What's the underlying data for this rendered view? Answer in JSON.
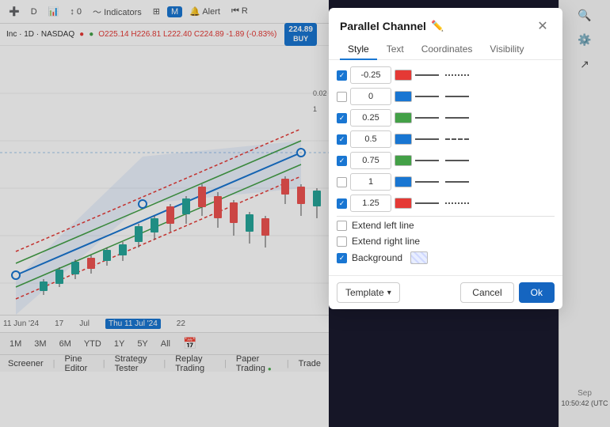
{
  "chart": {
    "stock": "Inc · 1D · NASDAQ",
    "ohlc": "O225.14 H226.81 L222.40 C224.89 -1.89 (-0.83%)",
    "price": "224.89",
    "price_action": "BUY",
    "time_axis": [
      "11 Jun '24",
      "17",
      "Jul",
      "22"
    ],
    "time_current": "Thu 11 Jul '24",
    "periods": [
      "1M",
      "3M",
      "6M",
      "YTD",
      "1Y",
      "5Y",
      "All"
    ],
    "footer_nav": [
      "Screener",
      "Pine Editor",
      "Strategy Tester",
      "Replay Trading",
      "Paper Trading",
      "Trade"
    ]
  },
  "modal": {
    "title": "Parallel Channel",
    "tabs": [
      "Style",
      "Text",
      "Coordinates",
      "Visibility"
    ],
    "active_tab": "Style",
    "lines": [
      {
        "checked": true,
        "value": "-0.25",
        "color": "#e53935",
        "style": "solid",
        "width": "normal"
      },
      {
        "checked": false,
        "value": "0",
        "color": "#1976d2",
        "style": "solid",
        "width": "normal"
      },
      {
        "checked": true,
        "value": "0.25",
        "color": "#43a047",
        "style": "solid",
        "width": "normal"
      },
      {
        "checked": true,
        "value": "0.5",
        "color": "#1976d2",
        "style": "solid",
        "width": "normal"
      },
      {
        "checked": true,
        "value": "0.75",
        "color": "#43a047",
        "style": "solid",
        "width": "normal"
      },
      {
        "checked": false,
        "value": "1",
        "color": "#1976d2",
        "style": "solid",
        "width": "normal"
      },
      {
        "checked": true,
        "value": "1.25",
        "color": "#e53935",
        "style": "dotted",
        "width": "normal"
      }
    ],
    "options": [
      {
        "id": "extend_left",
        "label": "Extend left line",
        "checked": false
      },
      {
        "id": "extend_right",
        "label": "Extend right line",
        "checked": false
      },
      {
        "id": "background",
        "label": "Background",
        "checked": true
      }
    ],
    "footer": {
      "template_label": "Template",
      "cancel_label": "Cancel",
      "ok_label": "Ok"
    }
  },
  "right_panel": {
    "time": "10:50:42 (UTC",
    "sep_label": "Sep"
  }
}
